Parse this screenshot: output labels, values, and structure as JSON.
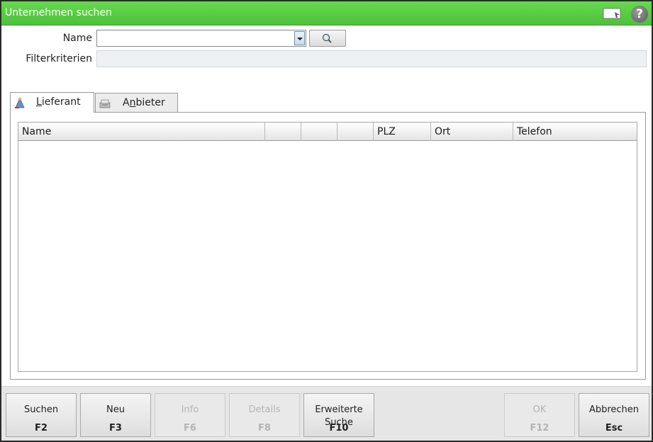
{
  "window": {
    "title": "Unternehmen suchen",
    "title_color": "#4cc13a",
    "icons": [
      "note-icon",
      "help-icon"
    ],
    "help_glyph": "?"
  },
  "form": {
    "name_label": "Name",
    "name_value": "",
    "filter_label": "Filterkriterien",
    "filter_value": ""
  },
  "tabs": [
    {
      "label_pre": "",
      "label_u": "L",
      "label_post": "ieferant",
      "active": true,
      "icon": "supplier-icon"
    },
    {
      "label_pre": "A",
      "label_u": "n",
      "label_post": "bieter",
      "active": false,
      "icon": "provider-icon"
    }
  ],
  "table": {
    "columns": [
      "Name",
      "",
      "",
      "",
      "PLZ",
      "Ort",
      "Telefon"
    ],
    "rows": []
  },
  "footer": {
    "buttons": [
      {
        "label": "Suchen",
        "key": "F2",
        "enabled": true
      },
      {
        "label": "Neu",
        "key": "F3",
        "enabled": true
      },
      {
        "label": "Info",
        "key": "F6",
        "enabled": false
      },
      {
        "label": "Details",
        "key": "F8",
        "enabled": false
      },
      {
        "label_line1": "Erweiterte",
        "label_line2": "Suche",
        "key": "F10",
        "enabled": true
      },
      {
        "label": "OK",
        "key": "F12",
        "enabled": false
      },
      {
        "label": "Abbrechen",
        "key": "Esc",
        "enabled": true
      }
    ]
  }
}
